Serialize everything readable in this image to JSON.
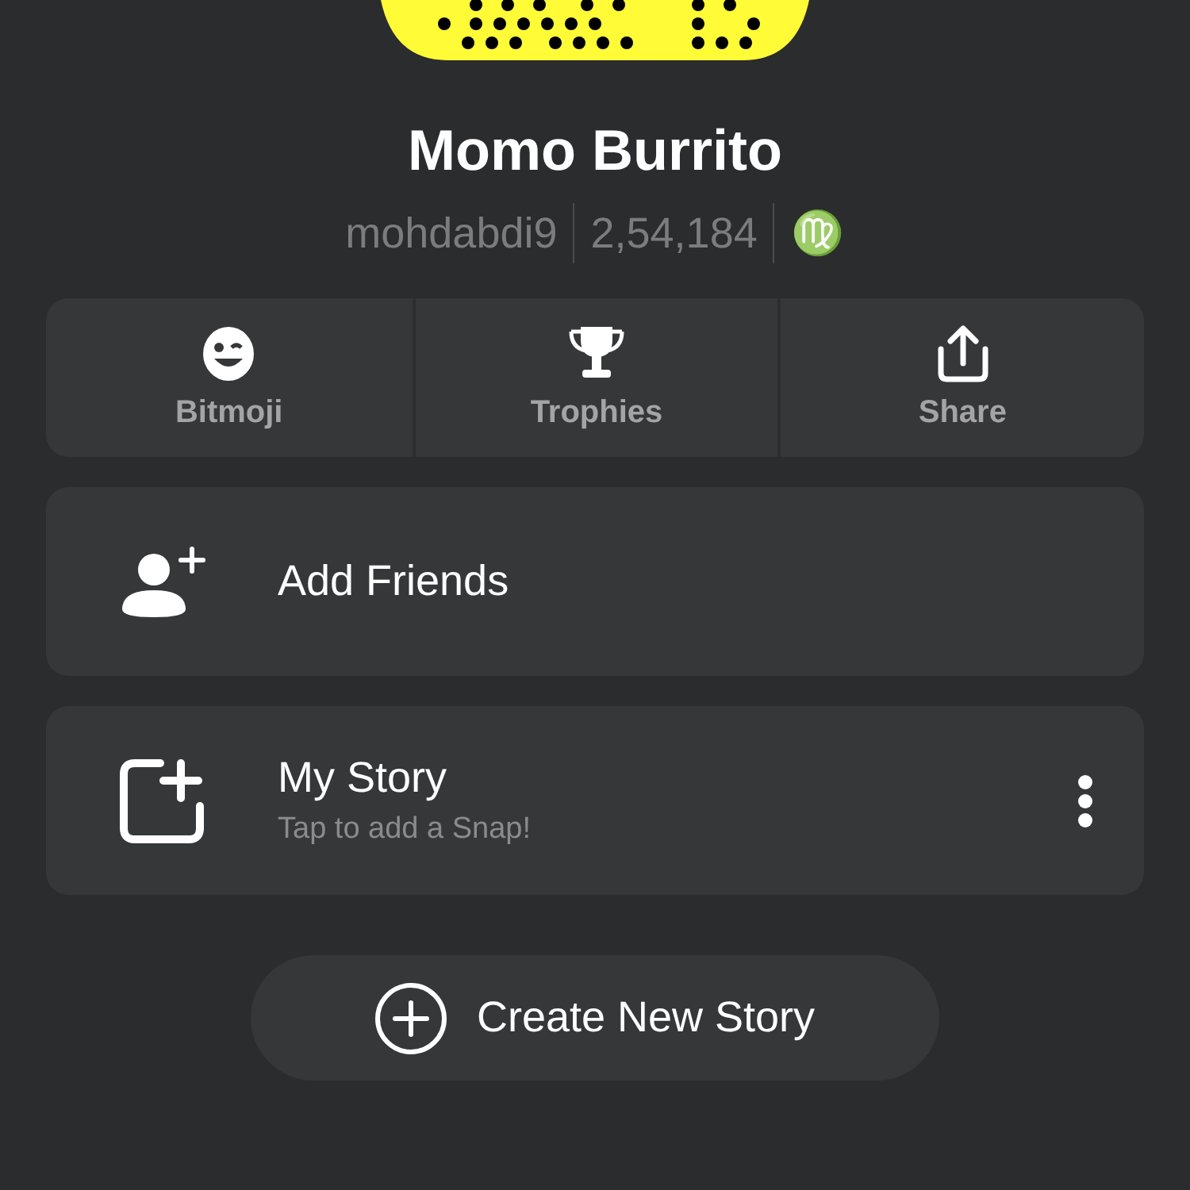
{
  "profile": {
    "name": "Momo Burrito",
    "username": "mohdabdi9",
    "score": "2,54,184",
    "zodiac": "♍"
  },
  "actions": [
    {
      "kind": "bitmoji",
      "label": "Bitmoji"
    },
    {
      "kind": "trophy",
      "label": "Trophies"
    },
    {
      "kind": "share",
      "label": "Share"
    }
  ],
  "add_friends": {
    "label": "Add Friends"
  },
  "my_story": {
    "title": "My Story",
    "subtitle": "Tap to add a Snap!"
  },
  "create_story": {
    "label": "Create New Story"
  }
}
